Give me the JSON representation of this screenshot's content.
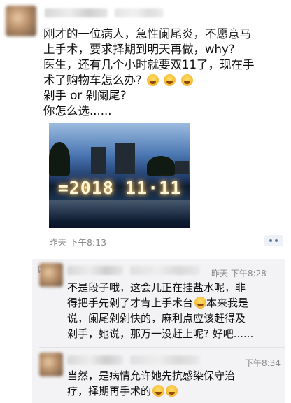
{
  "post": {
    "lines": [
      "刚才的一位病人，急性阑尾炎，不愿意马",
      "上手术，要求择期到明天再做，why?",
      "医生，还有几个小时就要双11了，现在手",
      "术了购物车怎么办?",
      "剁手 or 剁阑尾?",
      "你怎么选......"
    ],
    "photo_text": "=2018 11·11",
    "time": "昨天 下午8:13"
  },
  "comments": [
    {
      "time": "昨天 下午8:28",
      "lines": [
        "不是段子哦，这会儿正在挂盐水呢，非",
        "得把手先剁了才肯上手术台",
        "本来我是",
        "说，阑尾剁剁快的，麻利点应该赶得及",
        "剁手，她说，那万一没赶上呢? 好吧......"
      ]
    },
    {
      "time": "下午8:34",
      "lines": [
        "当然，是病情允许她先抗感染保守治",
        "疗，择期再手术的"
      ]
    }
  ]
}
